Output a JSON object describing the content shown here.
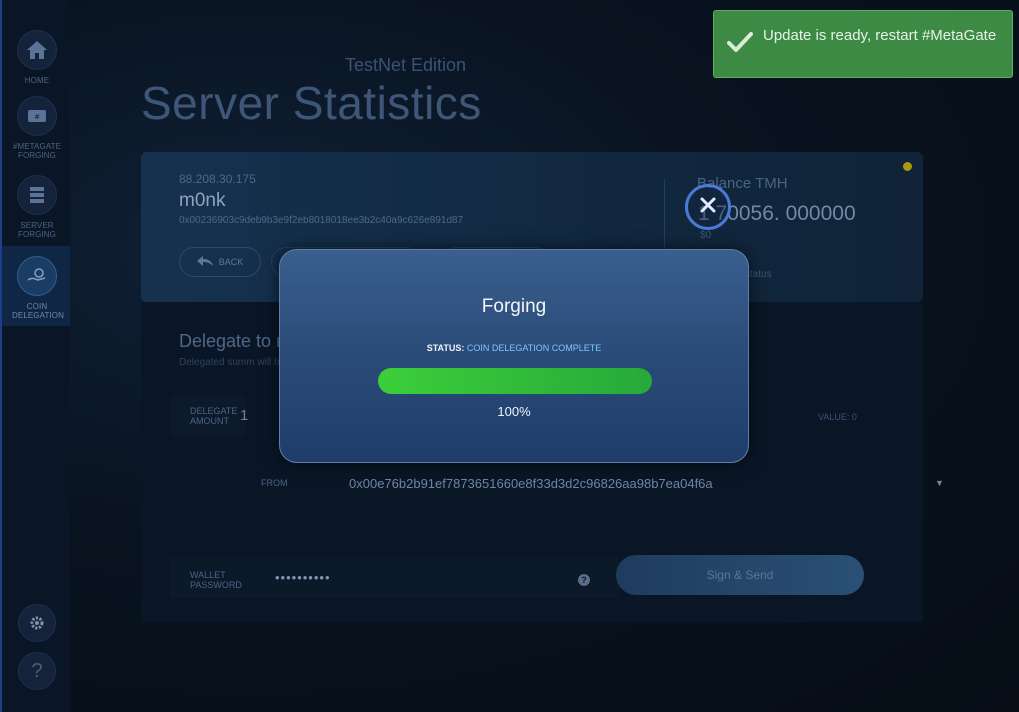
{
  "sidebar": {
    "items": [
      {
        "label": "HOME",
        "icon": "home-icon"
      },
      {
        "label": "#METAGATE FORGING",
        "icon": "wallet-tag-icon"
      },
      {
        "label": "SERVER FORGING",
        "icon": "server-icon"
      },
      {
        "label": "COIN DELEGATION",
        "icon": "hand-coin-icon",
        "active": true
      }
    ],
    "settings_icon": "gear-icon",
    "help_label": "?"
  },
  "header": {
    "edition": "TestNet Edition",
    "title": "Server Statistics"
  },
  "server_card": {
    "ip": "88.208.30.175",
    "name": "m0nk",
    "hash": "0x00236903c9deb9b3e9f2eb8018018ee3b2c40a9c626e891d87",
    "back_label": "BACK",
    "balance_label": "Balance TMH",
    "balance_value": "1 70056. 000000",
    "usd_value": "$0",
    "node_status_label": "de status",
    "status_color": "#a99a12"
  },
  "delegate": {
    "title": "Delegate to n",
    "subtitle": "Delegated summ will b",
    "amount_label_line1": "DELEGATE",
    "amount_label_line2": "AMOUNT",
    "amount_value": "1",
    "max_value": "VALUE: 0",
    "from_label": "FROM",
    "from_address": "0x00e76b2b91ef7873651660e8f33d3d2c96826aa98b7ea04f6a",
    "password_label_line1": "WALLET",
    "password_label_line2": "PASSWORD",
    "password_value": "••••••••••",
    "help_glyph": "?",
    "sign_button": "Sign & Send"
  },
  "modal": {
    "title": "Forging",
    "status_key": "STATUS:",
    "status_value": "COIN DELEGATION COMPLETE",
    "progress": 1.0,
    "progress_text": "100%"
  },
  "toast": {
    "message": "Update is ready, restart #MetaGate",
    "icon": "check-icon",
    "color": "#3d8a45"
  },
  "colors": {
    "accent_blue": "#4a7ad6",
    "progress_green": "#3ccf3a"
  }
}
